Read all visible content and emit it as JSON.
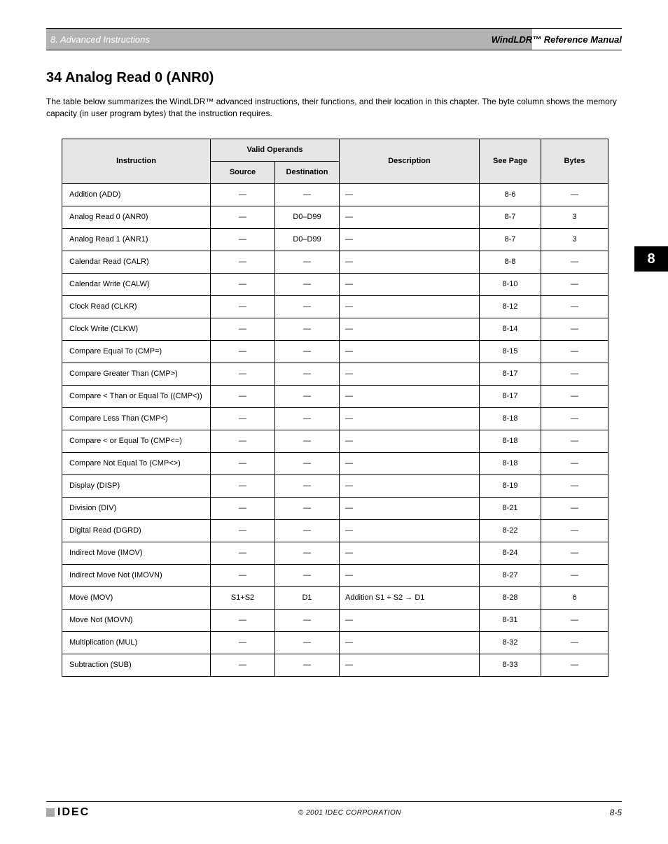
{
  "header": {
    "chapter_line": "8. Advanced Instructions",
    "manual_title": "WindLDR™ Reference Manual"
  },
  "section": {
    "title": "34  Analog Read 0 (ANR0)",
    "blurb": "The table below summarizes the WindLDR™ advanced instructions, their functions, and their location in this chapter. The byte column shows the memory capacity (in user program bytes) that the instruction requires."
  },
  "side_tab": "8",
  "footer": {
    "brand": "IDEC",
    "mid": "© 2001 IDEC CORPORATION",
    "page": "8-5"
  },
  "table": {
    "headers": {
      "instruction": "Instruction",
      "valid_operands": "Valid Operands",
      "source": "Source",
      "destination": "Destination",
      "description": "Description",
      "see_page": "See Page",
      "bytes": "Bytes"
    },
    "rows": [
      {
        "instr": "Addition (ADD)",
        "src": "—",
        "dst": "—",
        "desc": "—",
        "see": "8-6",
        "bytes": "—"
      },
      {
        "instr": "Analog Read 0 (ANR0)",
        "src": "—",
        "dst": "D0–D99",
        "desc": "—",
        "see": "8-7",
        "bytes": "3"
      },
      {
        "instr": "Analog Read 1 (ANR1)",
        "src": "—",
        "dst": "D0–D99",
        "desc": "—",
        "see": "8-7",
        "bytes": "3"
      },
      {
        "instr": "Calendar Read (CALR)",
        "src": "—",
        "dst": "—",
        "desc": "—",
        "see": "8-8",
        "bytes": "—"
      },
      {
        "instr": "Calendar Write (CALW)",
        "src": "—",
        "dst": "—",
        "desc": "—",
        "see": "8-10",
        "bytes": "—"
      },
      {
        "instr": "Clock Read (CLKR)",
        "src": "—",
        "dst": "—",
        "desc": "—",
        "see": "8-12",
        "bytes": "—"
      },
      {
        "instr": "Clock Write (CLKW)",
        "src": "—",
        "dst": "—",
        "desc": "—",
        "see": "8-14",
        "bytes": "—"
      },
      {
        "instr": "Compare Equal To (CMP=)",
        "src": "—",
        "dst": "—",
        "desc": "—",
        "see": "8-15",
        "bytes": "—"
      },
      {
        "instr": "Compare Greater Than (CMP>)",
        "src": "—",
        "dst": "—",
        "desc": "—",
        "see": "8-17",
        "bytes": "—"
      },
      {
        "instr": "Compare < Than or Equal To ((CMP<))",
        "src": "—",
        "dst": "—",
        "desc": "—",
        "see": "8-17",
        "bytes": "—"
      },
      {
        "instr": "Compare Less Than (CMP<)",
        "src": "—",
        "dst": "—",
        "desc": "—",
        "see": "8-18",
        "bytes": "—"
      },
      {
        "instr": "Compare < or Equal To (CMP<=)",
        "src": "—",
        "dst": "—",
        "desc": "—",
        "see": "8-18",
        "bytes": "—"
      },
      {
        "instr": "Compare Not Equal To (CMP<>)",
        "src": "—",
        "dst": "—",
        "desc": "—",
        "see": "8-18",
        "bytes": "—"
      },
      {
        "instr": "Display (DISP)",
        "src": "—",
        "dst": "—",
        "desc": "—",
        "see": "8-19",
        "bytes": "—"
      },
      {
        "instr": "Division (DIV)",
        "src": "—",
        "dst": "—",
        "desc": "—",
        "see": "8-21",
        "bytes": "—"
      },
      {
        "instr": "Digital Read (DGRD)",
        "src": "—",
        "dst": "—",
        "desc": "—",
        "see": "8-22",
        "bytes": "—"
      },
      {
        "instr": "Indirect Move (IMOV)",
        "src": "—",
        "dst": "—",
        "desc": "—",
        "see": "8-24",
        "bytes": "—"
      },
      {
        "instr": "Indirect Move Not (IMOVN)",
        "src": "—",
        "dst": "—",
        "desc": "—",
        "see": "8-27",
        "bytes": "—"
      },
      {
        "instr": "Move (MOV)",
        "src": "S1+S2",
        "dst": "D1",
        "desc": "Addition S1 + S2 → D1",
        "see": "8-28",
        "bytes": "6"
      },
      {
        "instr": "Move Not (MOVN)",
        "src": "—",
        "dst": "—",
        "desc": "—",
        "see": "8-31",
        "bytes": "—"
      },
      {
        "instr": "Multiplication (MUL)",
        "src": "—",
        "dst": "—",
        "desc": "—",
        "see": "8-32",
        "bytes": "—"
      },
      {
        "instr": "Subtraction (SUB)",
        "src": "—",
        "dst": "—",
        "desc": "—",
        "see": "8-33",
        "bytes": "—"
      }
    ]
  }
}
